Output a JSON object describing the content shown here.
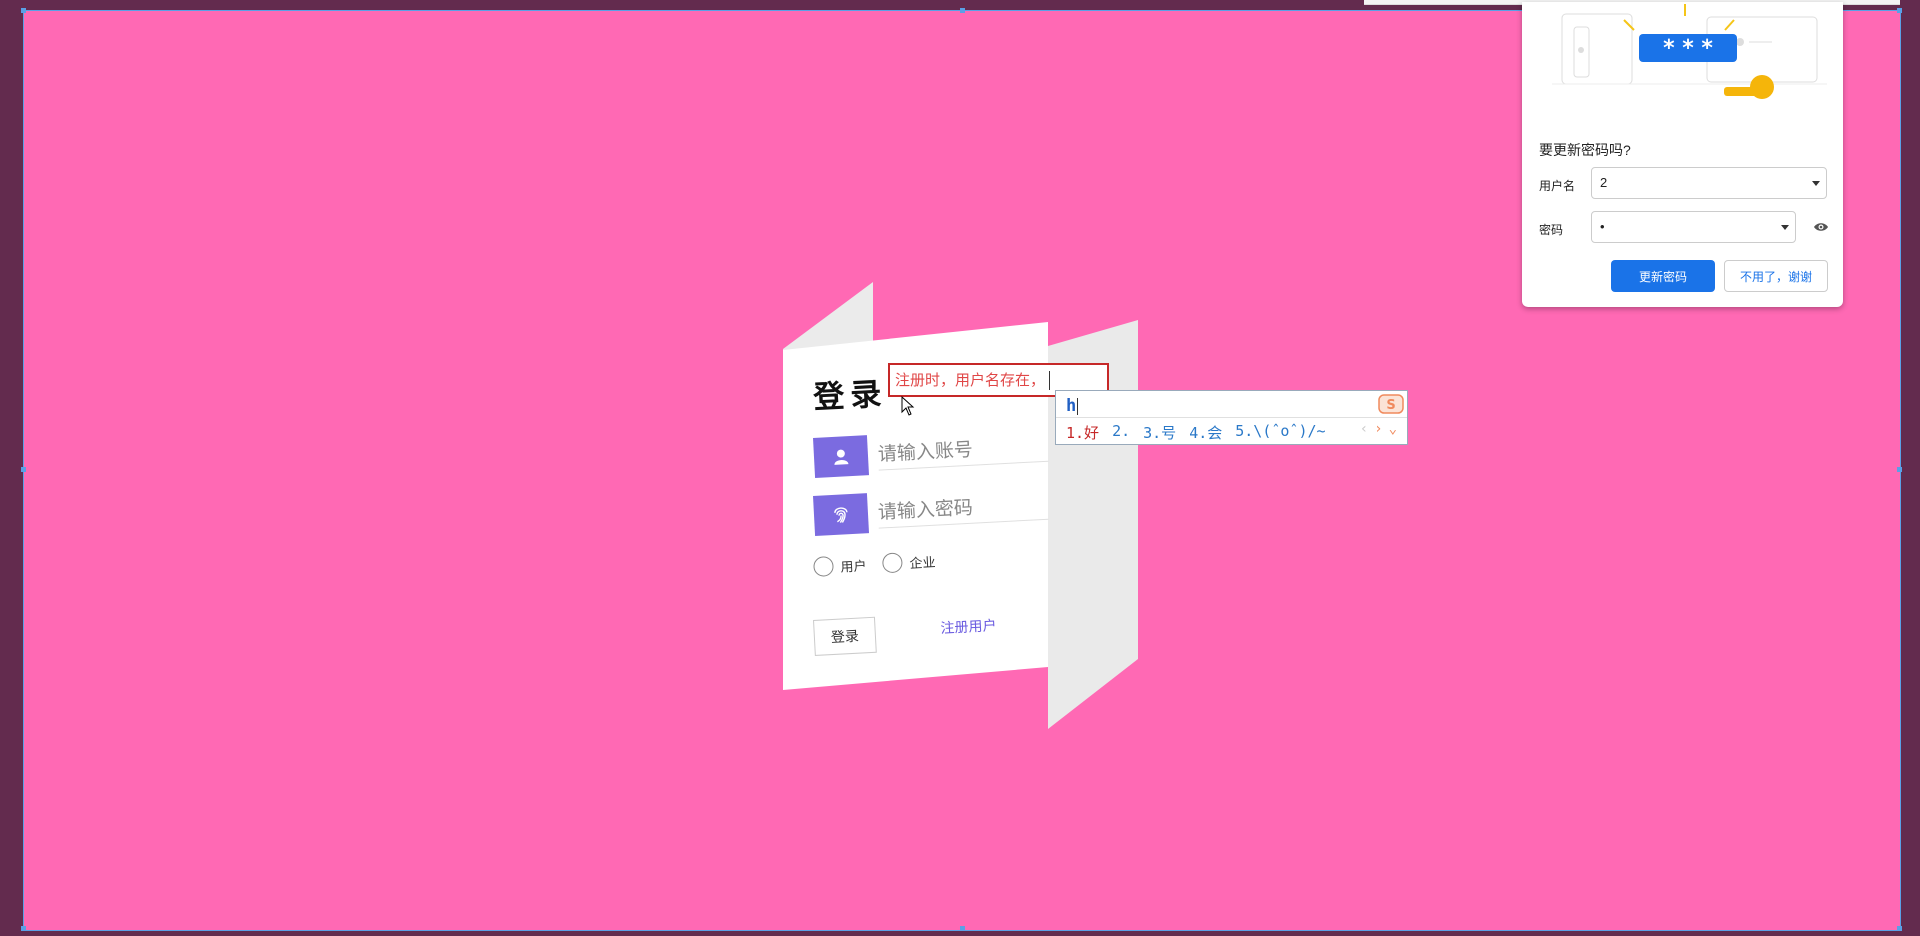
{
  "login": {
    "title": "登录",
    "error_message": "注册时，用户名存在，",
    "account_placeholder": "请输入账号",
    "password_placeholder": "请输入密码",
    "radio_user": "用户",
    "radio_enterprise": "企业",
    "login_button": "登录",
    "register_link": "注册用户"
  },
  "ime": {
    "composition": "h",
    "candidates": [
      "1.好",
      "2.",
      "3.号",
      "4.会",
      "5.\\(ˆoˆ)/~"
    ]
  },
  "password_popup": {
    "illustration_text": "* * *",
    "question": "要更新密码吗?",
    "username_label": "用户名",
    "username_value": "2",
    "password_label": "密码",
    "password_value": "•",
    "update_button": "更新密码",
    "dismiss_button": "不用了，谢谢"
  },
  "colors": {
    "page_background": "#ff69b4",
    "frame": "#632b4e",
    "icon_accent": "#7b6be0",
    "error": "#c62828",
    "primary_button": "#1a73e8"
  }
}
